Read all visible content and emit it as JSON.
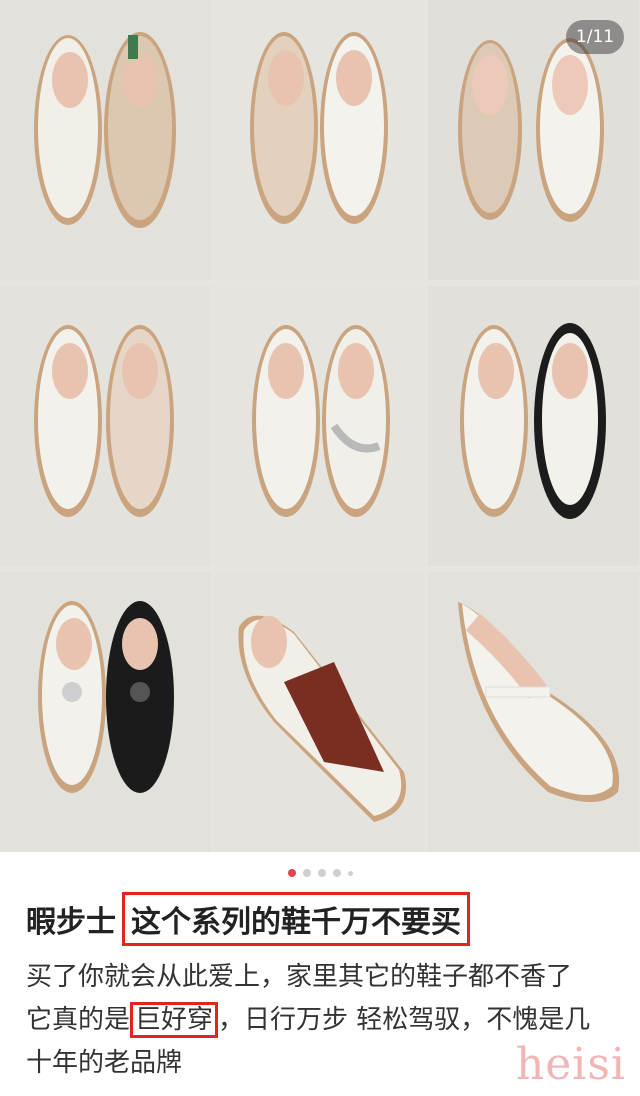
{
  "gallery": {
    "counter": "1/11",
    "tiles": [
      {
        "name": "shoe-pair-1"
      },
      {
        "name": "shoe-pair-2"
      },
      {
        "name": "shoe-pair-3"
      },
      {
        "name": "shoe-pair-4"
      },
      {
        "name": "shoe-pair-5"
      },
      {
        "name": "shoe-pair-6"
      },
      {
        "name": "shoe-pair-7"
      },
      {
        "name": "shoe-single-8"
      },
      {
        "name": "shoe-single-9"
      }
    ]
  },
  "post": {
    "title_prefix": "暇步士",
    "title_highlight": "这个系列的鞋千万不要买",
    "line1": "买了你就会从此爱上，家里其它的鞋子都不香了",
    "line2_a": "它真的是",
    "line2_highlight": "巨好穿",
    "line2_b": "，日行万步 轻松驾驭，不愧是几",
    "line3": "十年的老品牌"
  },
  "watermark": "heisi",
  "colors": {
    "highlight": "#e02424",
    "dot_active": "#e0454b"
  }
}
